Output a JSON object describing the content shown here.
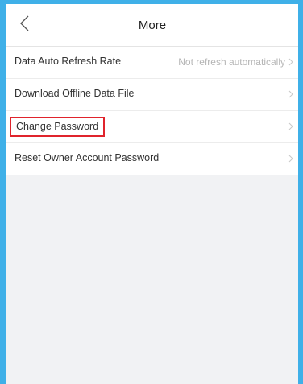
{
  "header": {
    "title": "More"
  },
  "icons": {
    "back": "chevron-left-icon",
    "row_arrow": "chevron-right-icon"
  },
  "colors": {
    "accent_border": "#3fb0e8",
    "highlight": "#e0242c"
  },
  "settings": [
    {
      "label": "Data Auto Refresh Rate",
      "value": "Not refresh automatically"
    },
    {
      "label": "Download Offline Data File",
      "value": ""
    },
    {
      "label": "Change Password",
      "value": "",
      "highlighted": true
    },
    {
      "label": "Reset Owner Account Password",
      "value": ""
    }
  ]
}
